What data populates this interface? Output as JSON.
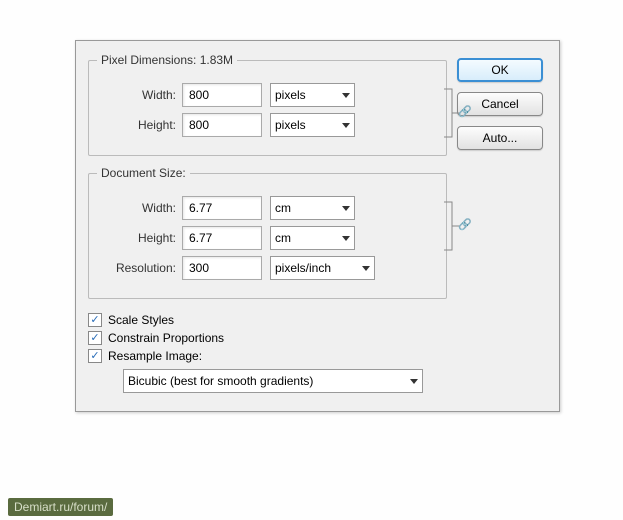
{
  "pixelDimensions": {
    "legend": "Pixel Dimensions:  1.83M",
    "widthLabel": "Width:",
    "widthValue": "800",
    "widthUnit": "pixels",
    "heightLabel": "Height:",
    "heightValue": "800",
    "heightUnit": "pixels"
  },
  "documentSize": {
    "legend": "Document Size:",
    "widthLabel": "Width:",
    "widthValue": "6.77",
    "widthUnit": "cm",
    "heightLabel": "Height:",
    "heightValue": "6.77",
    "heightUnit": "cm",
    "resolutionLabel": "Resolution:",
    "resolutionValue": "300",
    "resolutionUnit": "pixels/inch"
  },
  "checkboxes": {
    "scaleStyles": "Scale Styles",
    "constrainProportions": "Constrain Proportions",
    "resampleImage": "Resample Image:"
  },
  "resampleMethod": "Bicubic (best for smooth gradients)",
  "buttons": {
    "ok": "OK",
    "cancel": "Cancel",
    "auto": "Auto..."
  },
  "watermark": "Demiart.ru/forum/"
}
